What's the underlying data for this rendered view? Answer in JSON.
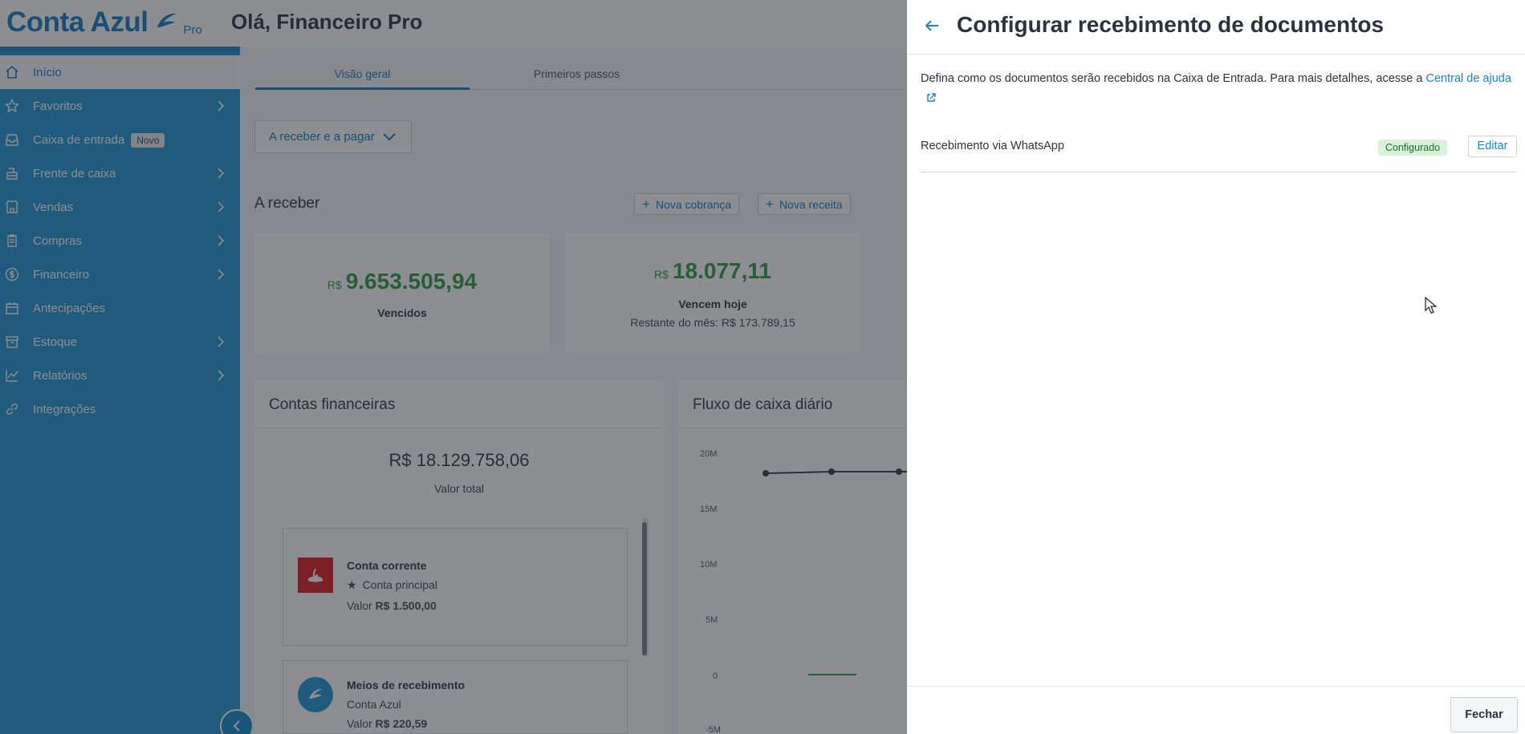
{
  "header": {
    "logo_text": "Conta Azul",
    "logo_badge": "Pro",
    "greeting": "Olá, Financeiro Pro"
  },
  "sidebar": {
    "items": [
      {
        "label": "Início",
        "icon": "home-icon",
        "active": true,
        "has_submenu": false
      },
      {
        "label": "Favoritos",
        "icon": "star-icon",
        "active": false,
        "has_submenu": true
      },
      {
        "label": "Caixa de entrada",
        "icon": "inbox-icon",
        "badge": "Novo",
        "active": false,
        "has_submenu": false
      },
      {
        "label": "Frente de caixa",
        "icon": "cash-register-icon",
        "active": false,
        "has_submenu": true
      },
      {
        "label": "Vendas",
        "icon": "store-icon",
        "active": false,
        "has_submenu": true
      },
      {
        "label": "Compras",
        "icon": "clipboard-icon",
        "active": false,
        "has_submenu": true
      },
      {
        "label": "Financeiro",
        "icon": "dollar-icon",
        "active": false,
        "has_submenu": true
      },
      {
        "label": "Antecipações",
        "icon": "calendar-icon",
        "active": false,
        "has_submenu": false
      },
      {
        "label": "Estoque",
        "icon": "box-icon",
        "active": false,
        "has_submenu": true
      },
      {
        "label": "Relatórios",
        "icon": "chart-icon",
        "active": false,
        "has_submenu": true
      },
      {
        "label": "Integrações",
        "icon": "link-icon",
        "active": false,
        "has_submenu": false
      }
    ]
  },
  "dashboard": {
    "tabs": [
      "Visão geral",
      "Primeiros passos"
    ],
    "dropdown_label": "A receber e a pagar",
    "receivables": {
      "title": "A receber",
      "new_charge_label": "Nova cobrança",
      "new_income_label": "Nova receita",
      "cards": [
        {
          "currency": "R$",
          "value": "9.653.505,94",
          "label": "Vencidos",
          "sub": ""
        },
        {
          "currency": "R$",
          "value": "18.077,11",
          "label": "Vencem hoje",
          "sub": "Restante do mês: R$ 173.789,15"
        }
      ]
    },
    "accounts": {
      "title": "Contas financeiras",
      "total_value": "R$ 18.129.758,06",
      "total_label": "Valor total",
      "items": [
        {
          "name": "Conta corrente",
          "detail": "Conta principal",
          "value_prefix": "Valor",
          "value": "R$ 1.500,00",
          "icon": "santander-logo-icon"
        },
        {
          "name": "Meios de recebimento",
          "detail": "Conta Azul",
          "value_prefix": "Valor",
          "value": "R$ 220,59",
          "icon": "conta-azul-logo-icon"
        }
      ]
    },
    "cashflow": {
      "title": "Fluxo de caixa diário",
      "y_ticks": [
        "20M",
        "15M",
        "10M",
        "5M",
        "0",
        "-5M"
      ]
    }
  },
  "drawer": {
    "title": "Configurar recebimento de documentos",
    "description": "Defina como os documentos serão recebidos na Caixa de Entrada. Para mais detalhes, acesse a ",
    "help_link": "Central de ajuda",
    "row_label": "Recebimento via WhatsApp",
    "status": "Configurado",
    "edit_label": "Editar",
    "close_label": "Fechar"
  },
  "colors": {
    "brand_blue": "#1a84c9",
    "sidebar_blue": "#2b9ad6",
    "positive_green": "#3aa24d",
    "badge_green_bg": "#d8f1d9"
  }
}
